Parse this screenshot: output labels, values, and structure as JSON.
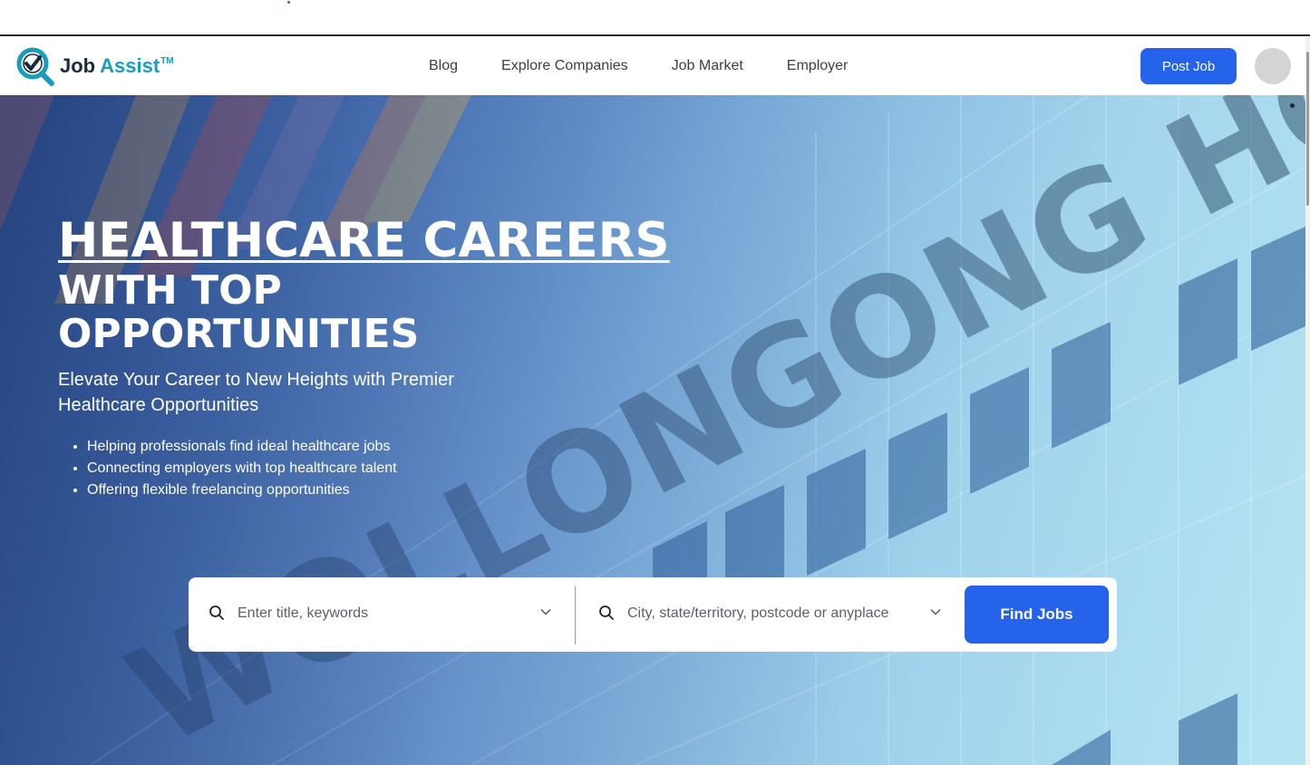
{
  "brand": {
    "job": "Job",
    "assist": "Assist",
    "tm": "TM",
    "accent": "#1a9dbb"
  },
  "nav": {
    "links": [
      "Blog",
      "Explore Companies",
      "Job Market",
      "Employer"
    ],
    "post_job": "Post Job"
  },
  "hero": {
    "title": "HEALTHCARE CAREERS",
    "subtitle_line": "WITH TOP OPPORTUNITIES",
    "tagline": "Elevate Your Career to New Heights with Premier Healthcare Opportunities",
    "bullets": [
      "Helping professionals find ideal healthcare jobs",
      "Connecting employers with top healthcare talent",
      "Offering flexible freelancing opportunities"
    ]
  },
  "search": {
    "keyword_placeholder": "Enter title, keywords",
    "location_placeholder": "City, state/territory, postcode or anyplace",
    "button": "Find Jobs"
  },
  "icons": {
    "logo": "magnifier-check-icon",
    "search": "search-icon",
    "chevron": "chevron-down-icon"
  },
  "colors": {
    "primary": "#2563eb",
    "avatar": "#d4d4d4"
  }
}
